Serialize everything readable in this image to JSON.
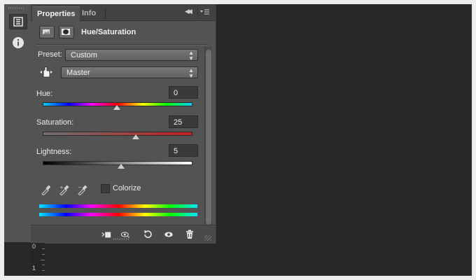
{
  "tabs": [
    {
      "label": "Properties",
      "active": true
    },
    {
      "label": "Info",
      "active": false
    }
  ],
  "panel_title": "Hue/Saturation",
  "preset": {
    "label": "Preset:",
    "value": "Custom"
  },
  "channel": {
    "value": "Master"
  },
  "adjustments": [
    {
      "label": "Hue:",
      "value": "0",
      "position": 0.5
    },
    {
      "label": "Saturation:",
      "value": "25",
      "position": 0.625
    },
    {
      "label": "Lightness:",
      "value": "5",
      "position": 0.525
    }
  ],
  "colorize": {
    "label": "Colorize",
    "checked": false
  },
  "ruler": {
    "labels": [
      "0",
      "1"
    ]
  },
  "icons": {
    "toolstrip": [
      "adjustment-properties-icon",
      "info-icon"
    ],
    "header": [
      "adjustment-layer-icon",
      "mask-icon"
    ],
    "eyedroppers": [
      "eyedropper-icon",
      "eyedropper-plus-icon",
      "eyedropper-minus-icon"
    ],
    "bottom": [
      "clip-to-layer-icon",
      "view-previous-state-icon",
      "reset-icon",
      "visibility-eye-icon",
      "delete-trash-icon"
    ],
    "target_adjust": "targeted-adjustment-hand-icon"
  },
  "colors": {
    "panel_bg": "#535353",
    "canvas_bg": "#282828",
    "hue_track": "rainbow",
    "saturation_track": "#c02020",
    "lightness_track": "black-to-white"
  }
}
